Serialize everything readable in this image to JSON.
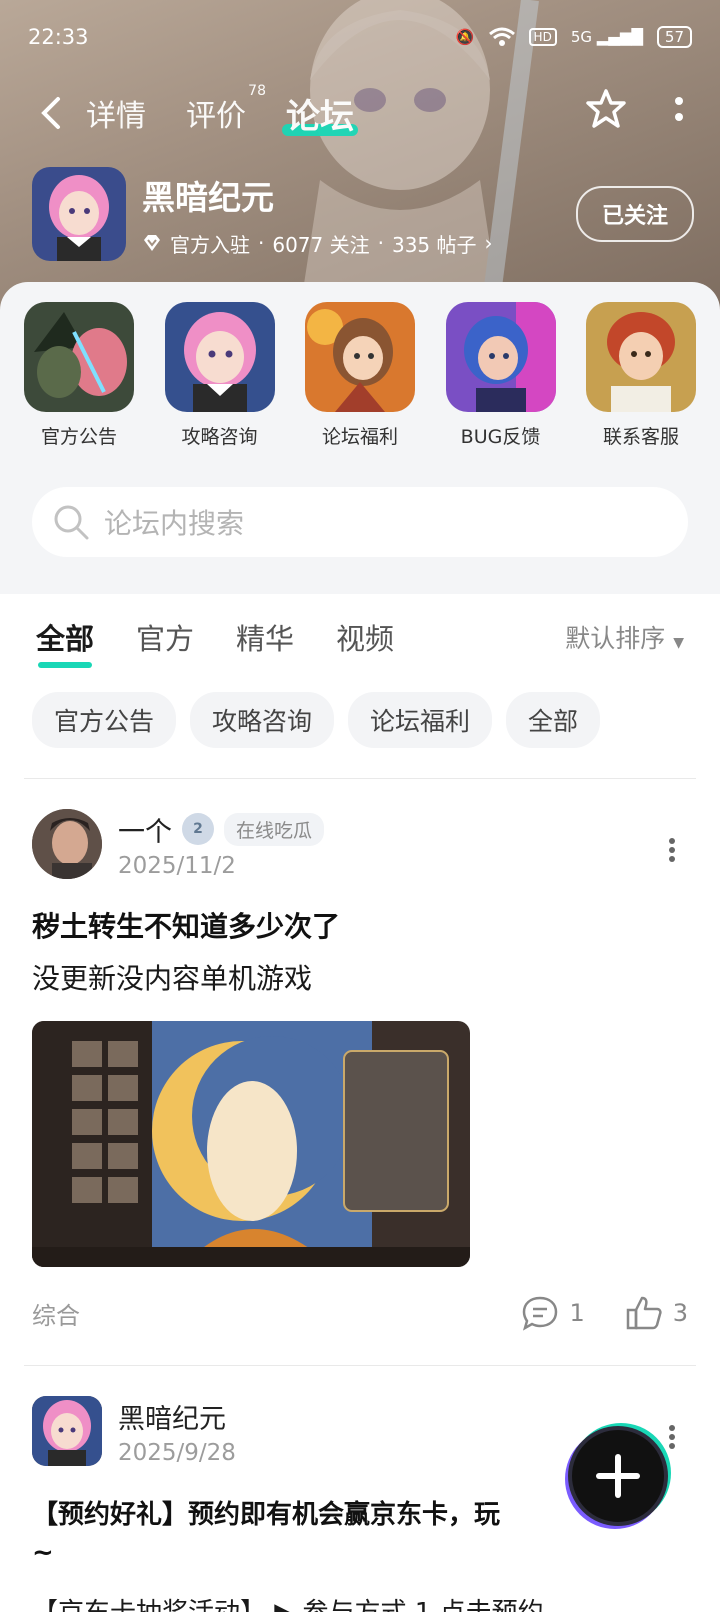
{
  "status_bar": {
    "time": "22:33",
    "network": "5G",
    "battery": "57"
  },
  "nav": {
    "tabs": [
      {
        "label": "详情",
        "badge": ""
      },
      {
        "label": "评价",
        "badge": "78"
      },
      {
        "label": "论坛",
        "badge": ""
      }
    ],
    "active_tab": "论坛"
  },
  "game": {
    "name": "黑暗纪元",
    "official": "官方入驻",
    "followers": "6077 关注",
    "posts": "335 帖子",
    "follow_label": "已关注"
  },
  "categories": [
    {
      "label": "官方公告"
    },
    {
      "label": "攻略咨询"
    },
    {
      "label": "论坛福利"
    },
    {
      "label": "BUG反馈"
    },
    {
      "label": "联系客服"
    }
  ],
  "search": {
    "placeholder": "论坛内搜索"
  },
  "feed_tabs": [
    "全部",
    "官方",
    "精华",
    "视频"
  ],
  "sort_label": "默认排序",
  "chips": [
    "官方公告",
    "攻略咨询",
    "论坛福利",
    "全部"
  ],
  "posts": [
    {
      "author": "一个",
      "level": "2",
      "badge": "在线吃瓜",
      "date": "2025/11/2",
      "title": "秽土转生不知道多少次了",
      "body": "没更新没内容单机游戏",
      "tag": "综合",
      "comments": "1",
      "likes": "3"
    },
    {
      "author": "黑暗纪元",
      "date": "2025/9/28",
      "title": "【预约好礼】预约即有机会赢京东卡，玩",
      "title_cont": "~",
      "line": "【京东卡抽奖活动】 ▶ 参与方式 1.点击预约"
    }
  ],
  "colors": {
    "accent": "#19d7b6",
    "header": "#a49283"
  }
}
